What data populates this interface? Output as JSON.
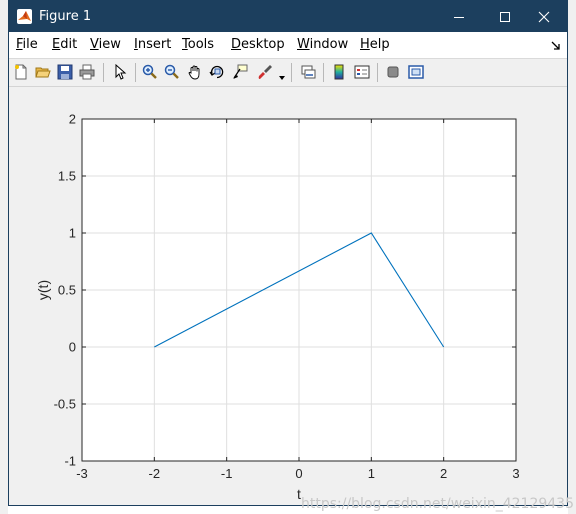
{
  "window": {
    "title": "Figure 1",
    "titlebar_color": "#1c3f5e"
  },
  "menu": [
    {
      "label": "File",
      "mnemonic": "F",
      "rest": "ile"
    },
    {
      "label": "Edit",
      "mnemonic": "E",
      "rest": "dit"
    },
    {
      "label": "View",
      "mnemonic": "V",
      "rest": "iew"
    },
    {
      "label": "Insert",
      "mnemonic": "I",
      "rest": "nsert"
    },
    {
      "label": "Tools",
      "mnemonic": "T",
      "rest": "ools"
    },
    {
      "label": "Desktop",
      "mnemonic": "D",
      "rest": "esktop"
    },
    {
      "label": "Window",
      "mnemonic": "W",
      "rest": "indow"
    },
    {
      "label": "Help",
      "mnemonic": "H",
      "rest": "elp"
    }
  ],
  "toolbar": {
    "icons": [
      "new-figure-icon",
      "open-file-icon",
      "save-icon",
      "print-icon",
      "edit-plot-arrow-icon",
      "zoom-in-icon",
      "zoom-out-icon",
      "pan-hand-icon",
      "rotate-3d-icon",
      "data-cursor-icon",
      "brush-icon",
      "link-plot-icon",
      "insert-colorbar-icon",
      "insert-legend-icon",
      "hide-plot-tools-icon",
      "show-plot-tools-icon"
    ]
  },
  "chart_data": {
    "type": "line",
    "x": [
      -2,
      1,
      2
    ],
    "y": [
      0,
      1,
      0
    ],
    "series_color": "#0072bd",
    "xlim": [
      -3,
      3
    ],
    "ylim": [
      -1,
      2
    ],
    "xticks": [
      "-3",
      "-2",
      "-1",
      "0",
      "1",
      "2",
      "3"
    ],
    "yticks": [
      "-1",
      "-0.5",
      "0",
      "0.5",
      "1",
      "1.5",
      "2"
    ],
    "xlabel": "t",
    "ylabel": "y(t)",
    "grid": true
  },
  "watermark": "https://blog.csdn.net/weixin_42129435"
}
